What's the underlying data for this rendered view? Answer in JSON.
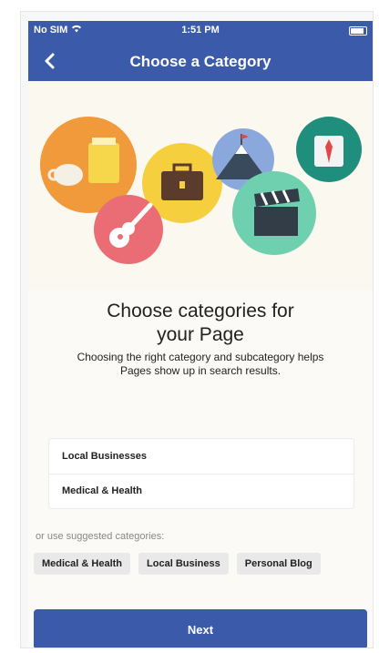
{
  "status_bar": {
    "carrier": "No SIM",
    "time": "1:51 PM"
  },
  "nav": {
    "title": "Choose a Category"
  },
  "heading": {
    "line1": "Choose categories for",
    "line2": "your Page"
  },
  "subtext": {
    "line1": "Choosing the right category and subcategory helps",
    "line2": "Pages show up in search results."
  },
  "categories": [
    "Local Businesses",
    "Medical & Health"
  ],
  "suggested": {
    "label": "or use suggested categories:",
    "chips": [
      "Medical & Health",
      "Local Business",
      "Personal Blog"
    ]
  },
  "next_button": {
    "label": "Next"
  },
  "colors": {
    "brand": "#3b5aa9",
    "hero_bg": "#fbf8ef"
  },
  "icons": [
    "wifi-icon",
    "battery-icon",
    "back-chevron-icon",
    "coffee-icon",
    "briefcase-icon",
    "guitar-icon",
    "mountain-icon",
    "clapperboard-icon",
    "shirt-tie-icon"
  ]
}
